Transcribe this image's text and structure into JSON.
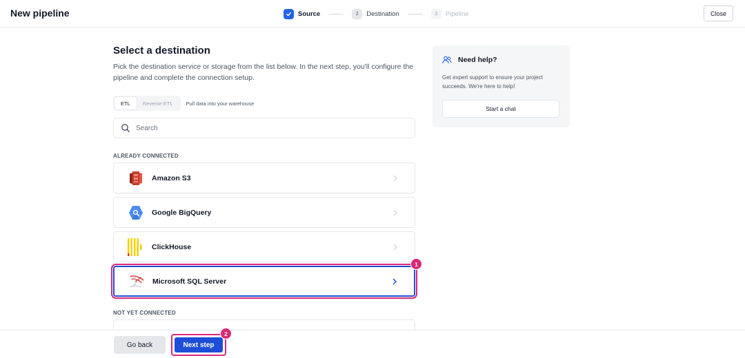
{
  "header": {
    "title": "New pipeline",
    "steps": [
      {
        "number": "",
        "label": "Source",
        "state": "done"
      },
      {
        "number": "2",
        "label": "Destination",
        "state": "current"
      },
      {
        "number": "3",
        "label": "Pipeline",
        "state": "future"
      }
    ],
    "close_label": "Close"
  },
  "main": {
    "title": "Select a destination",
    "description": "Pick the destination service or storage from the list below. In the next step, you'll configure the pipeline and complete the connection setup.",
    "toggle": {
      "options": [
        "ETL",
        "Reverse ETL"
      ],
      "selected": "ETL",
      "hint": "Pull data into your warehouse"
    },
    "search": {
      "placeholder": "Search",
      "value": ""
    },
    "already_connected_label": "ALREADY CONNECTED",
    "already_connected": [
      {
        "name": "Amazon S3",
        "icon": "amazon-s3-icon"
      },
      {
        "name": "Google BigQuery",
        "icon": "google-bigquery-icon"
      },
      {
        "name": "ClickHouse",
        "icon": "clickhouse-icon"
      },
      {
        "name": "Microsoft SQL Server",
        "icon": "microsoft-sql-server-icon",
        "selected": true
      }
    ],
    "not_connected_label": "NOT YET CONNECTED"
  },
  "help": {
    "title": "Need help?",
    "text": "Get expert support to ensure your project succeeds. We're here to help!",
    "button_label": "Start a chat"
  },
  "footer": {
    "back_label": "Go back",
    "next_label": "Next step"
  },
  "annotations": [
    "1",
    "2"
  ],
  "colors": {
    "accent": "#1d4ed8",
    "highlight": "#db2777",
    "muted": "#6b7280"
  }
}
